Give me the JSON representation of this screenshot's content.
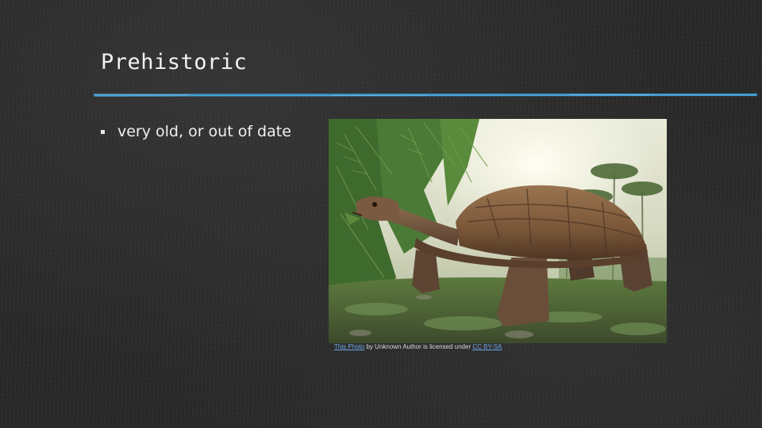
{
  "slide": {
    "title": "Prehistoric",
    "bullets": [
      {
        "text": "very old, or out of date"
      }
    ],
    "image": {
      "icon": "prehistoric-tortoise-photo"
    },
    "caption": {
      "link1": "This Photo",
      "middle": " by Unknown Author is licensed under ",
      "link2": "CC BY-SA"
    }
  },
  "colors": {
    "background": "#1f1f1f",
    "text": "#f2f2f2",
    "rule": "#3a9fd8",
    "link": "#6fa8e8"
  }
}
